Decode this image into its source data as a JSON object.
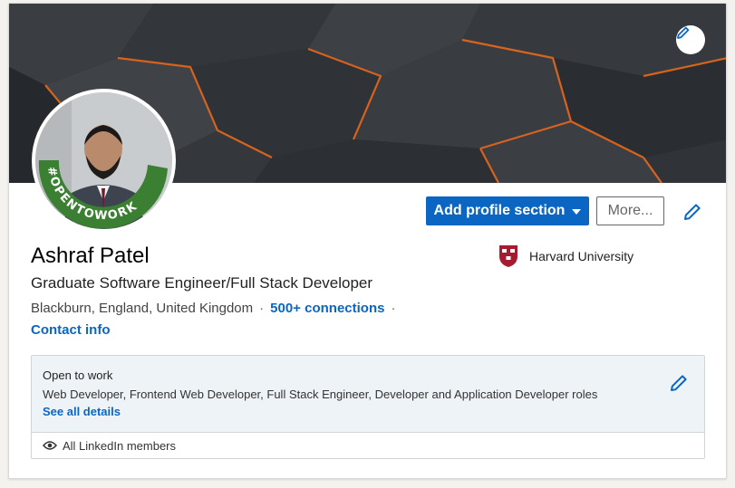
{
  "profile": {
    "name": "Ashraf Patel",
    "headline": "Graduate Software Engineer/Full Stack Developer",
    "location": "Blackburn, England, United Kingdom",
    "connections": "500+ connections",
    "contact_info": "Contact info",
    "avatar_frame_text": "#OPENTOWORK"
  },
  "actions": {
    "add_section_label": "Add profile section",
    "more_label": "More..."
  },
  "education": {
    "name": "Harvard University"
  },
  "open_to_work": {
    "title": "Open to work",
    "roles": "Web Developer, Frontend Web Developer, Full Stack Engineer, Developer and Application Developer roles",
    "details_link": "See all details",
    "visibility": "All LinkedIn members"
  },
  "colors": {
    "accent": "#0a66c2",
    "banner_line": "#e0661c",
    "otw_green": "#3a7f32"
  }
}
